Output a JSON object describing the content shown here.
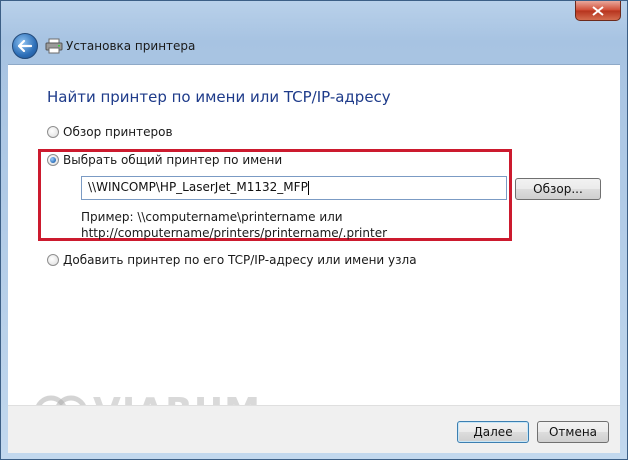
{
  "window": {
    "title": "Установка принтера"
  },
  "main": {
    "heading": "Найти принтер по имени или TCP/IP-адресу",
    "options": [
      {
        "label": "Обзор принтеров",
        "checked": false
      },
      {
        "label": "Выбрать общий принтер по имени",
        "checked": true
      },
      {
        "label": "Добавить принтер по его TCP/IP-адресу или имени узла",
        "checked": false
      }
    ],
    "share_input": {
      "value": "\\\\WINCOMP\\HP_LaserJet_M1132_MFP"
    },
    "browse_label": "Обзор...",
    "example_line1": "Пример: \\\\computername\\printername или",
    "example_line2": "http://computername/printers/printername/.printer"
  },
  "footer": {
    "next_label": "Далее",
    "cancel_label": "Отмена"
  },
  "watermark": {
    "text": "VIARUM"
  },
  "colors": {
    "heading": "#1e3b8a",
    "highlight_border": "#cc1a2e",
    "title_gradient": "#b9d1ea",
    "close_button": "#cf4a33"
  },
  "icons": [
    "close-icon",
    "back-arrow-icon",
    "printer-icon",
    "watermark-logo-icon"
  ]
}
